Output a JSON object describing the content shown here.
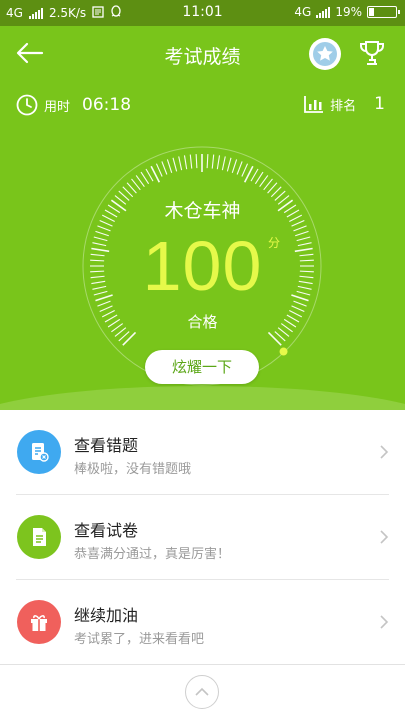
{
  "status_bar": {
    "network": "4G",
    "speed": "2.5K/s",
    "time": "11:01",
    "network_right": "4G",
    "battery": "19%",
    "battery_level": 0.19
  },
  "header": {
    "title": "考试成绩",
    "back_icon": "back-arrow-icon",
    "star_icon": "star-badge-icon",
    "trophy_icon": "trophy-icon"
  },
  "stats": {
    "time_label": "用时",
    "time_value": "06:18",
    "rank_label": "排名",
    "rank_value": "1"
  },
  "result": {
    "title": "木仓车神",
    "score": "100",
    "unit": "分",
    "status": "合格",
    "share_button": "炫耀一下",
    "score_fraction": 1.0
  },
  "actions": [
    {
      "title": "查看错题",
      "subtitle": "棒极啦，没有错题哦",
      "icon": "wrong-question-icon",
      "color": "#3fa9f0"
    },
    {
      "title": "查看试卷",
      "subtitle": "恭喜满分通过，真是厉害！",
      "icon": "paper-icon",
      "color": "#7dc41e"
    },
    {
      "title": "继续加油",
      "subtitle": "考试累了，进来看看吧",
      "icon": "gift-icon",
      "color": "#f0605c"
    }
  ],
  "footer": {
    "icon": "chevron-up-icon"
  },
  "colors": {
    "primary": "#79c51b",
    "score": "#e6f94a",
    "status_bar": "#5d8f12"
  }
}
